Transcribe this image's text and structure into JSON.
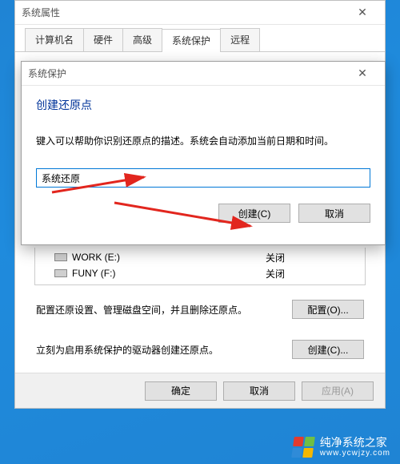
{
  "sysprops": {
    "title": "系统属性",
    "tabs": [
      "计算机名",
      "硬件",
      "高级",
      "系统保护",
      "远程"
    ],
    "drives": [
      {
        "name": "WORK (E:)",
        "status": "关闭"
      },
      {
        "name": "FUNY (F:)",
        "status": "关闭"
      }
    ],
    "configure_text": "配置还原设置、管理磁盘空间，并且删除还原点。",
    "configure_btn": "配置(O)...",
    "create_text": "立刻为启用系统保护的驱动器创建还原点。",
    "create_btn": "创建(C)...",
    "ok_btn": "确定",
    "cancel_btn": "取消",
    "apply_btn": "应用(A)"
  },
  "dialog": {
    "title": "系统保护",
    "heading": "创建还原点",
    "desc": "键入可以帮助你识别还原点的描述。系统会自动添加当前日期和时间。",
    "input_value": "系统还原",
    "create_btn": "创建(C)",
    "cancel_btn": "取消"
  },
  "watermark": {
    "line1": "纯净系统之家",
    "line2": "www.ycwjzy.com",
    "colors": [
      "#e23b2e",
      "#6fbf44",
      "#2f8bd8",
      "#f3b700"
    ]
  }
}
